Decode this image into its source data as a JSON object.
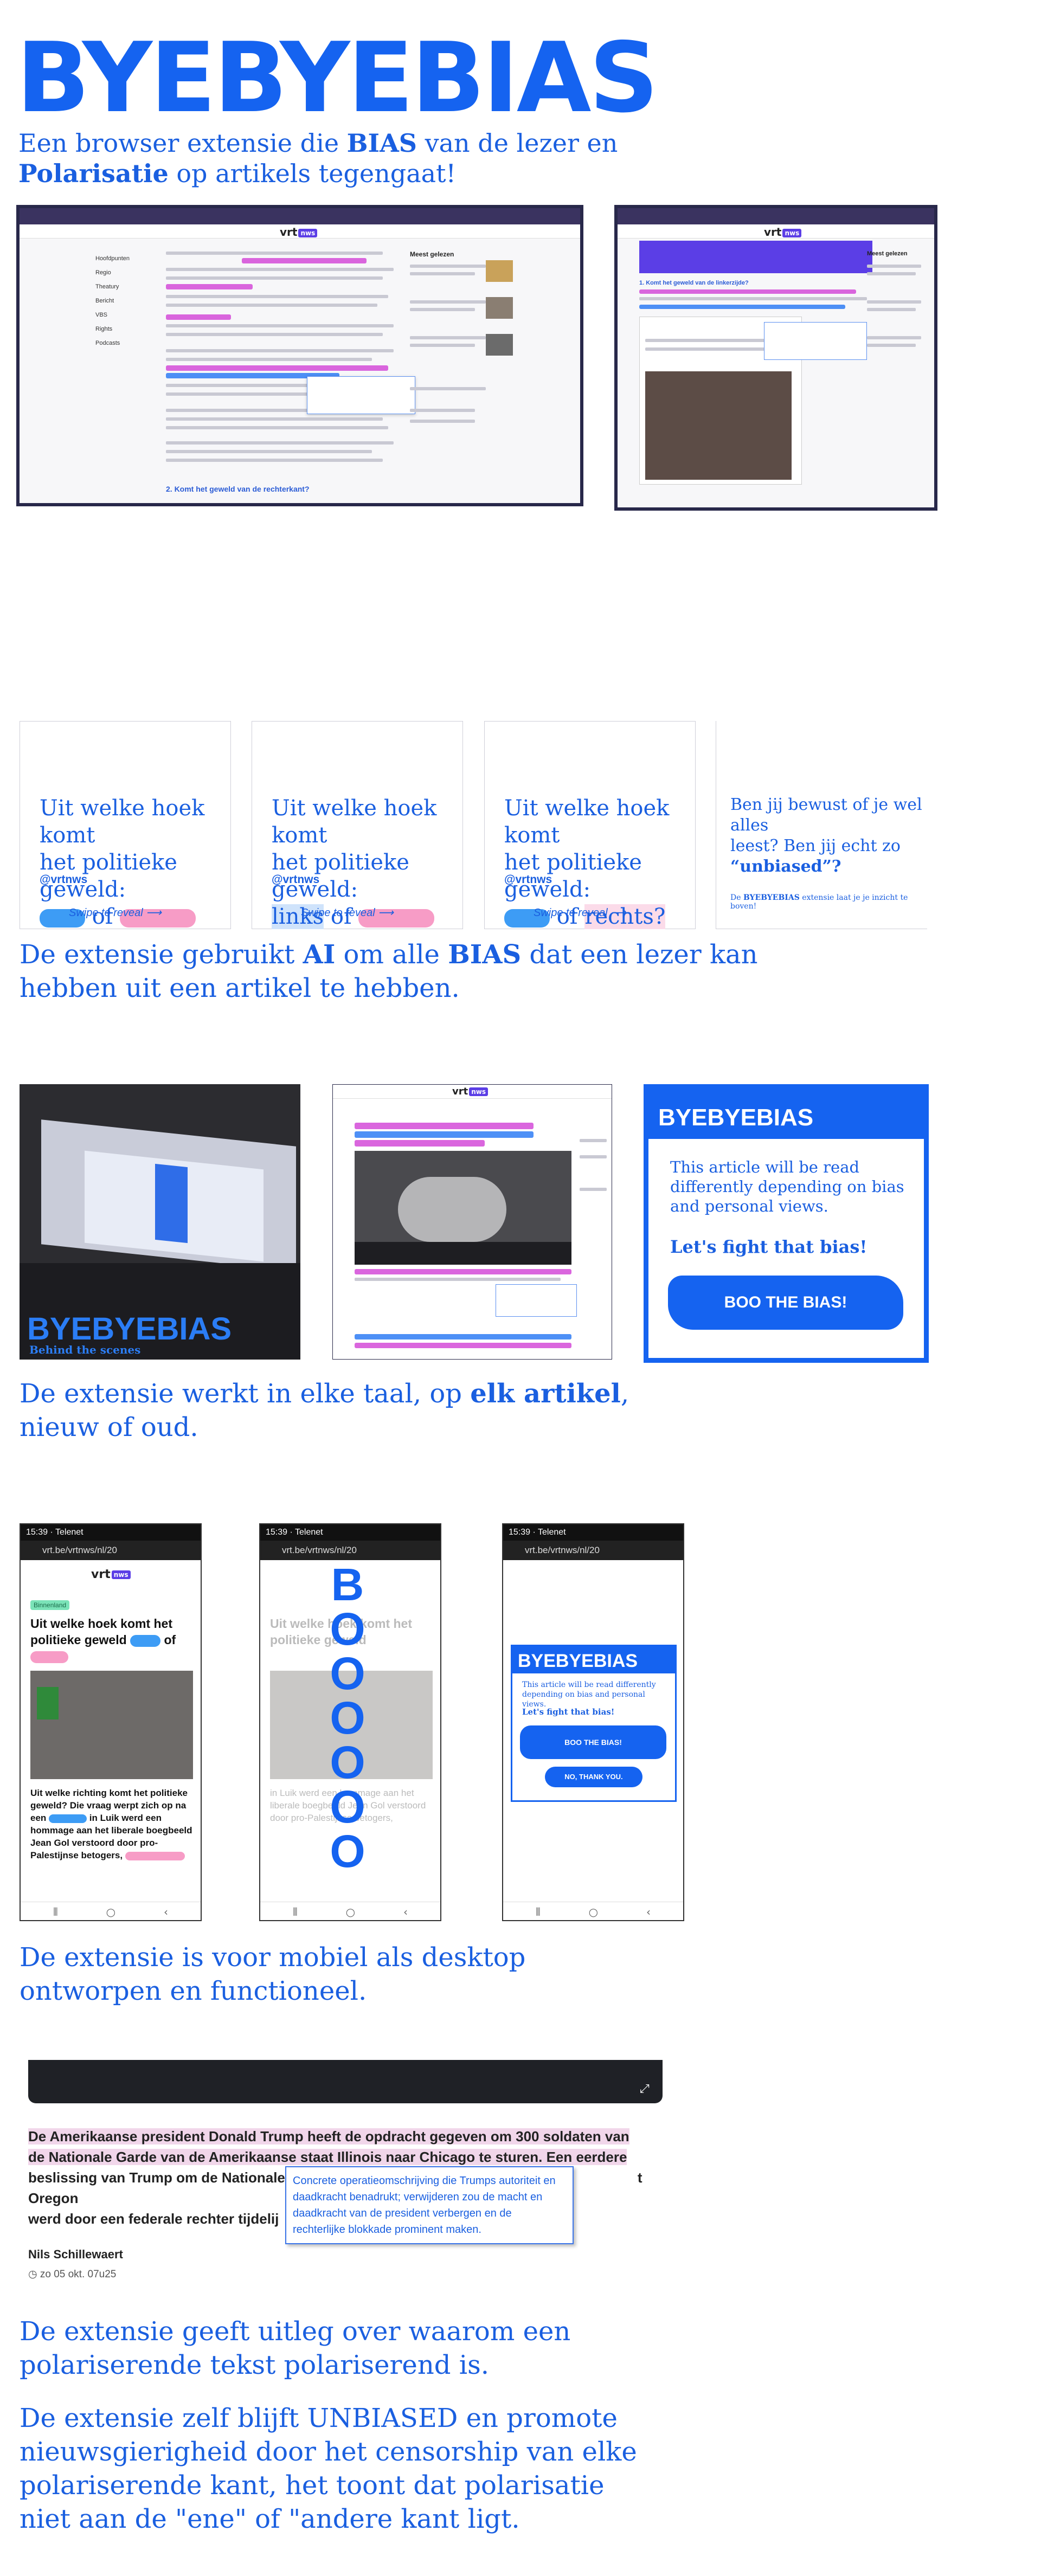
{
  "header": {
    "logo": "BYEBYEBIAS",
    "lead_prefix": "Een browser extensie die ",
    "lead_bold1": "BIAS",
    "lead_mid": " van de lezer en",
    "lead_bold2": "Polarisatie",
    "lead_suffix": " op artikels tegengaat!"
  },
  "desktop_shot": {
    "brand": "vrt",
    "brand_badge": "nws",
    "sidebar_items": [
      "Hoofdpunten",
      "Regio",
      "Theatury",
      "Bericht",
      "VBS",
      "Rights",
      "Podcasts"
    ],
    "most_read": "Meest gelezen",
    "question": "2. Komt het geweld van de rechterkant?"
  },
  "desktop_shot2": {
    "section": "1. Komt het geweld van de linkerzijde?",
    "most_read": "Meest gelezen"
  },
  "cards": [
    {
      "q1": "Uit welke hoek komt",
      "q2": "het politieke geweld:",
      "w1": "",
      "mid": "of",
      "w2": "",
      "handle": "@vrtnws",
      "swipe": "Swipe to reveal"
    },
    {
      "q1": "Uit welke hoek komt",
      "q2": "het politieke geweld:",
      "w1": "links",
      "mid": "of",
      "w2": "",
      "handle": "@vrtnws",
      "swipe": "Swipe to reveal"
    },
    {
      "q1": "Uit welke hoek komt",
      "q2": "het politieke geweld:",
      "w1": "",
      "mid": "of",
      "w2": "rechts?",
      "handle": "@vrtnws",
      "swipe": "Swipe to reveal"
    }
  ],
  "card4": {
    "l1": "Ben jij bewust of je wel alles",
    "l2": "leest? Ben jij echt zo",
    "l3": "“unbiased”?",
    "foot_prefix": "De ",
    "foot_bold": "BYEBYEBIAS",
    "foot_suffix": " extensie laat je je inzicht te boven!"
  },
  "caption1": {
    "p1": "De extensie gebruikt ",
    "b1": "AI",
    "p2": " om alle ",
    "b2": "BIAS",
    "p3": " dat een lezer kan",
    "line2": "hebben uit een artikel te hebben."
  },
  "behind": {
    "title": "BYEBYEBIAS",
    "sub": "Behind the scenes"
  },
  "popup": {
    "title": "BYEBYEBIAS",
    "body": "This article will be read differently depending on bias and personal views.",
    "cta": "Let's fight that bias!",
    "button": "BOO THE BIAS!"
  },
  "caption2": {
    "p1": "De extensie werkt in elke taal, op ",
    "b1": "elk artikel",
    "p2": ",",
    "line2": "nieuw of oud."
  },
  "phones": {
    "time": "15:39",
    "carrier": "Telenet",
    "url": "vrt.be/vrtnws/nl/20",
    "badge": "Binnenland",
    "headline": "Uit welke hoek komt het politieke geweld",
    "headline_of": "of",
    "body": "Uit welke richting komt het politieke geweld? Die vraag werpt zich op na een",
    "body2": "in Luik werd een hommage aan het liberale boegbeeld Jean Gol verstoord door pro-Palestijnse betogers,",
    "boo": "BOOOOOO",
    "popup_title": "BYEBYEBIAS",
    "popup_body": "This article will be read differently depending on bias and personal views.",
    "popup_cta": "Let's fight that bias!",
    "popup_btn": "BOO THE BIAS!",
    "popup_no": "NO, THANK YOU."
  },
  "caption3": {
    "line1": "De extensie is voor mobiel als desktop",
    "line2": "ontworpen en functioneel."
  },
  "article": {
    "p1": "De Amerikaanse president Donald Trump heeft de opdracht gegeven om 300 soldaten van",
    "p2": "de Nationale Garde van de Amerikaanse staat Illinois naar Chicago te sturen. Een eerdere",
    "p3": "beslissing van Trump om de Nationale",
    "p3b": "t Oregon",
    "p4": "werd door een federale rechter tijdelij",
    "author": "Nils Schillewaert",
    "date": "zo 05 okt. 07u25",
    "tooltip": "Concrete operatieomschrijving die Trumps autoriteit en daadkracht benadrukt; verwijderen zou de macht en daadkracht van de president verbergen en de rechterlijke blokkade prominent maken."
  },
  "caption4": {
    "line1": "De extensie geeft uitleg over waarom een",
    "line2": "polariserende tekst polariserend is."
  },
  "caption5": {
    "line1": "De extensie zelf blijft UNBIASED en promote",
    "line2": "nieuwsgierigheid door het censorship van elke",
    "line3": "polariserende kant, het toont dat polarisatie",
    "line4": "niet aan de \"ene\" of \"andere kant ligt."
  }
}
